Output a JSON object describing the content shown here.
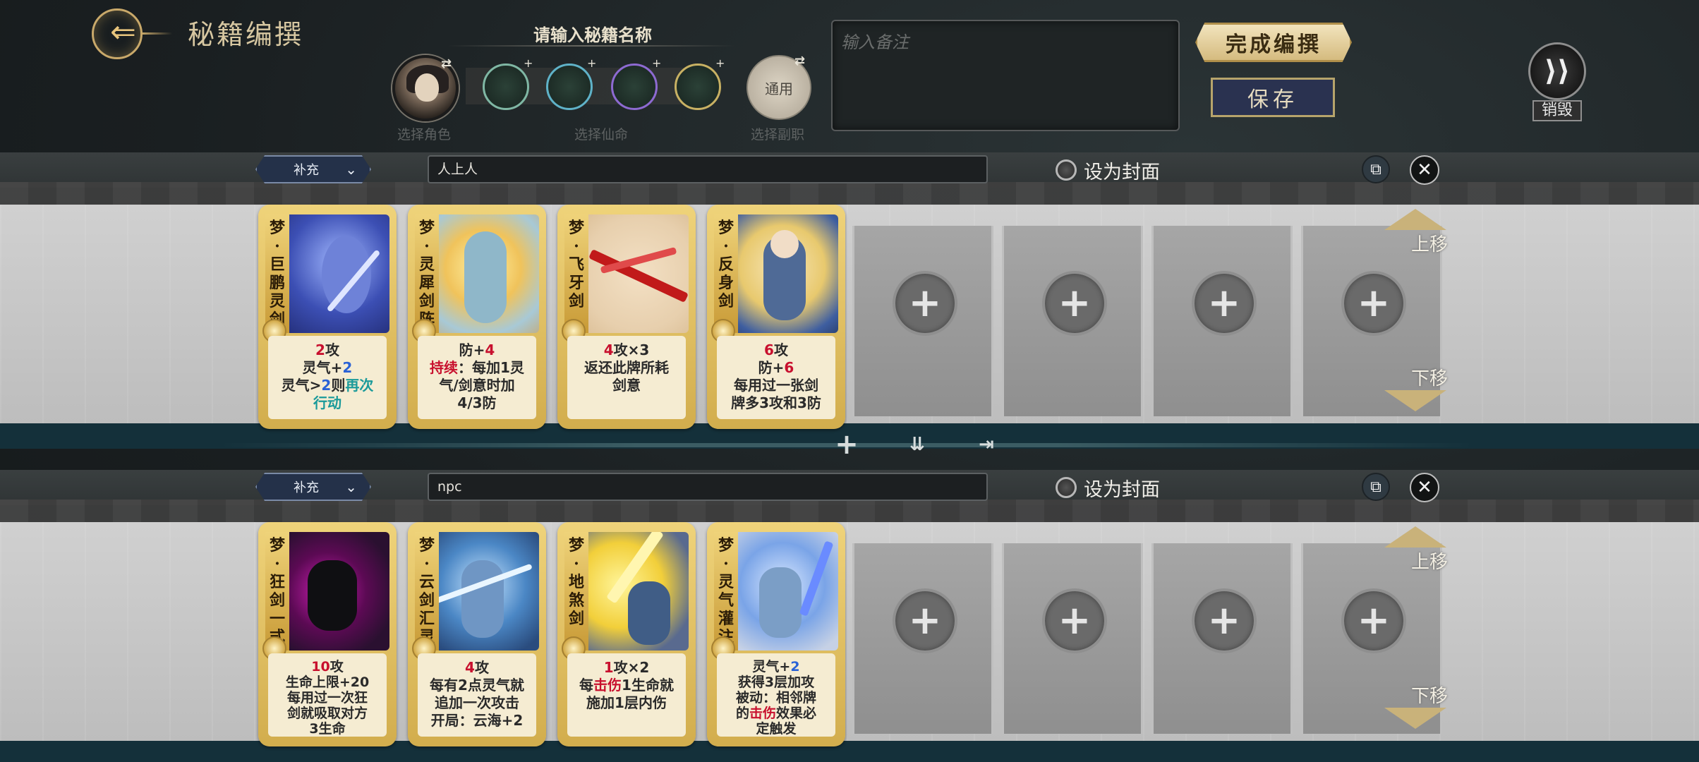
{
  "header": {
    "title": "秘籍编撰",
    "name_prompt": "请输入秘籍名称",
    "slot_captions": {
      "character": "选择角色",
      "fate": "选择仙命",
      "side_job": "选择副职"
    },
    "side_job_value": "通用",
    "note_placeholder": "输入备注",
    "finish_label": "完成编撰",
    "save_label": "保存",
    "destroy_label": "销毁"
  },
  "decks": [
    {
      "type": "补充",
      "name": "人上人",
      "cover_label": "设为封面",
      "move_up": "上移",
      "move_down": "下移",
      "cards": [
        {
          "prefix": "梦",
          "name": [
            "巨",
            "鹏",
            "灵",
            "剑"
          ]
        },
        {
          "prefix": "梦",
          "name": [
            "灵",
            "犀",
            "剑",
            "阵"
          ]
        },
        {
          "prefix": "梦",
          "name": [
            "飞",
            "牙",
            "剑"
          ]
        },
        {
          "prefix": "梦",
          "name": [
            "反",
            "身",
            "剑"
          ]
        }
      ]
    },
    {
      "type": "补充",
      "name": "npc",
      "cover_label": "设为封面",
      "move_up": "上移",
      "move_down": "下移",
      "cards": [
        {
          "prefix": "梦",
          "name": [
            "狂",
            "剑",
            "一",
            "式"
          ]
        },
        {
          "prefix": "梦",
          "name": [
            "云",
            "剑",
            "汇",
            "灵"
          ]
        },
        {
          "prefix": "梦",
          "name": [
            "地",
            "煞",
            "剑"
          ]
        },
        {
          "prefix": "梦",
          "name": [
            "灵",
            "气",
            "灌",
            "注"
          ]
        }
      ]
    }
  ],
  "card_text": {
    "c1_l1_n": "2",
    "c1_l1_t": "攻",
    "c1_l2_a": "灵气+",
    "c1_l2_n": "2",
    "c1_l3_a": "灵气>",
    "c1_l3_n": "2",
    "c1_l3_b": "则",
    "c1_l3_c": "再次",
    "c1_l4": "行动",
    "c2_l1_a": "防+",
    "c2_l1_n": "4",
    "c2_l2_a": "持续",
    "c2_l2_b": "：每加1灵",
    "c2_l3": "气/剑意时加",
    "c2_l4": "4/3防",
    "c3_l1_n": "4",
    "c3_l1_t": "攻×3",
    "c3_l2": "返还此牌所耗",
    "c3_l3": "剑意",
    "c4_l1_n": "6",
    "c4_l1_t": "攻",
    "c4_l2_a": "防+",
    "c4_l2_n": "6",
    "c4_l3": "每用过一张剑",
    "c4_l4": "牌多3攻和3防",
    "c5_l1_n": "10",
    "c5_l1_t": "攻",
    "c5_l2": "生命上限+20",
    "c5_l3": "每用过一次狂",
    "c5_l4": "剑就吸取对方",
    "c5_l5": "3生命",
    "c6_l1_n": "4",
    "c6_l1_t": "攻",
    "c6_l2": "每有2点灵气就",
    "c6_l3": "追加一次攻击",
    "c6_l4": "开局：云海+2",
    "c7_l1_n": "1",
    "c7_l1_t": "攻×2",
    "c7_l2_a": "每",
    "c7_l2_b": "击伤",
    "c7_l2_c": "1生命就",
    "c7_l3": "施加1层内伤",
    "c8_l1_a": "灵气+",
    "c8_l1_n": "2",
    "c8_l2": "获得3层加攻",
    "c8_l3": "被动：相邻牌",
    "c8_l4_a": "的",
    "c8_l4_b": "击伤",
    "c8_l4_c": "效果必",
    "c8_l5": "定触发"
  },
  "empty_slot_symbol": "+",
  "colors": {
    "gold": "#d2ad4d",
    "accent_red": "#c8102e",
    "accent_teal": "#1a9a9a",
    "accent_blue": "#2a62d6"
  }
}
